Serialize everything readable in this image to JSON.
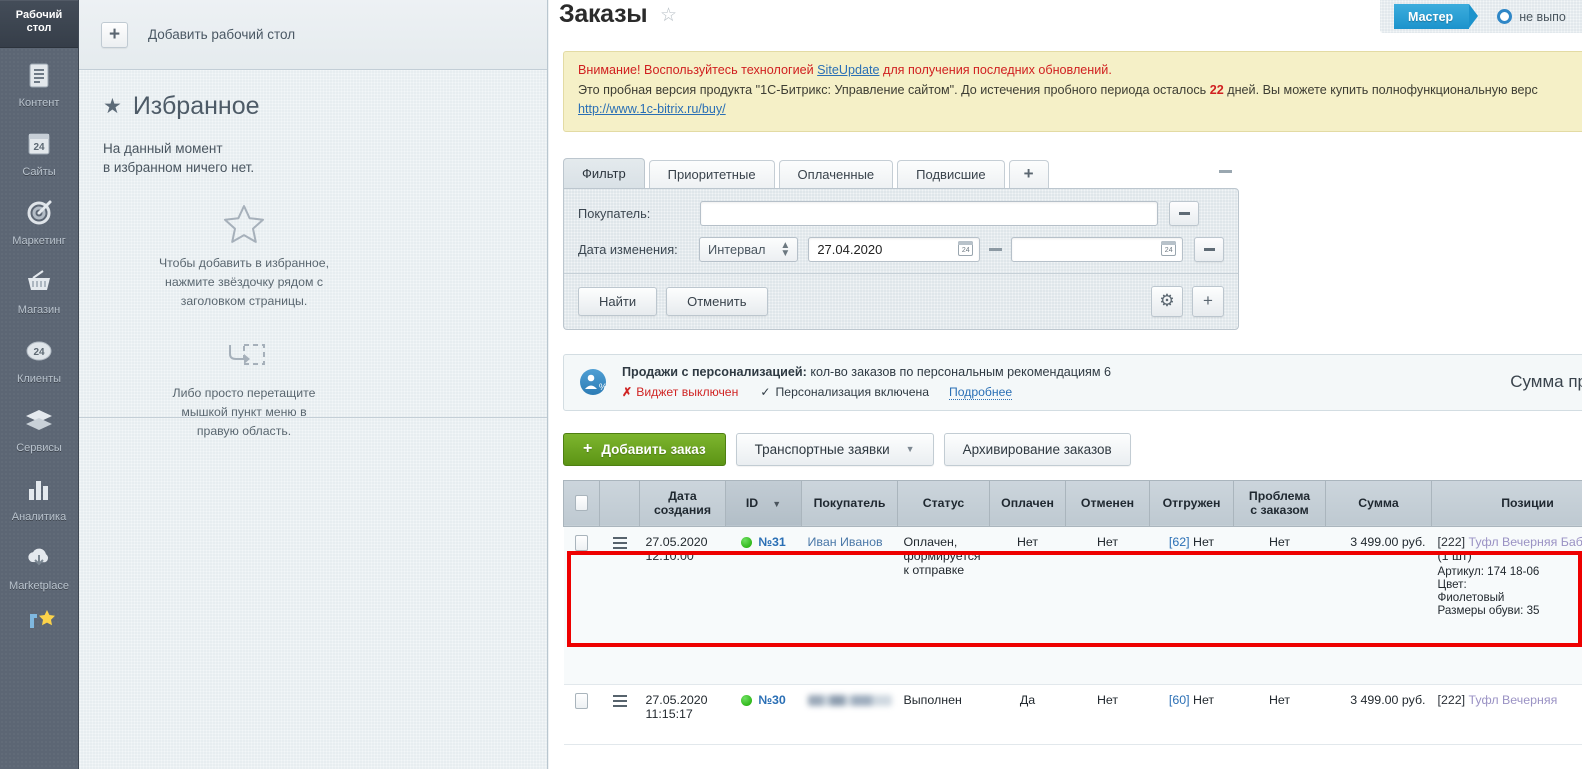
{
  "sidebar": {
    "desktop_label": "Рабочий\nстол",
    "desktop_line1": "Рабочий",
    "desktop_line2": "стол",
    "items": [
      {
        "label": "Контент",
        "icon": "content-lines-icon"
      },
      {
        "label": "Сайты",
        "icon": "sites-24-icon"
      },
      {
        "label": "Маркетинг",
        "icon": "marketing-target-icon"
      },
      {
        "label": "Магазин",
        "icon": "shop-basket-icon"
      },
      {
        "label": "Клиенты",
        "icon": "clients-24-icon"
      },
      {
        "label": "Сервисы",
        "icon": "services-layers-icon"
      },
      {
        "label": "Аналитика",
        "icon": "analytics-bars-icon"
      },
      {
        "label": "Marketplace",
        "icon": "marketplace-cloud-icon"
      },
      {
        "label": "",
        "icon": "settings-star-icon"
      }
    ]
  },
  "favorites": {
    "add_desktop_label": "Добавить рабочий стол",
    "title": "Избранное",
    "empty_line1": "На данный момент",
    "empty_line2": "в избранном ничего нет.",
    "hint1_line1": "Чтобы добавить в избранное,",
    "hint1_line2": "нажмите звёздочку рядом с",
    "hint1_line3": "заголовком страницы.",
    "hint2_line1": "Либо просто перетащите",
    "hint2_line2": "мышкой пункт меню в",
    "hint2_line3": "правую область."
  },
  "header": {
    "page_title": "Заказы",
    "star_icon": "favorite-star-icon",
    "master_button": "Мастер",
    "radio_label": "не выпо"
  },
  "warning": {
    "line1_prefix": "Внимание! Воспользуйтесь технологией ",
    "line1_link": "SiteUpdate",
    "line1_suffix": " для получения последних обновлений.",
    "line2_a": "Это пробная версия продукта \"1С-Битрикс: Управление сайтом\". До истечения пробного периода осталось ",
    "line2_days": "22",
    "line2_b": " дней. Вы можете купить полнофункциональную верс",
    "link_url": "http://www.1c-bitrix.ru/buy/"
  },
  "filter": {
    "tabs": [
      {
        "label": "Фильтр",
        "active": true
      },
      {
        "label": "Приоритетные",
        "active": false
      },
      {
        "label": "Оплаченные",
        "active": false
      },
      {
        "label": "Подвисшие",
        "active": false
      },
      {
        "label": "+",
        "active": false
      }
    ],
    "buyer_label": "Покупатель:",
    "buyer_value": "",
    "buyer_placeholder": "",
    "date_label": "Дата изменения:",
    "date_mode": "Интервал",
    "date_from": "27.04.2020",
    "date_to": "",
    "date_to_placeholder": "",
    "find_button": "Найти",
    "cancel_button": "Отменить",
    "gear_icon": "gear-icon",
    "add_icon": "plus-icon"
  },
  "personalization": {
    "title_text": "Продажи с персонализацией:",
    "detail_text": " кол-во заказов по персональным рекомендациям 6",
    "widget_off": "Виджет выключен",
    "perso_on": "Персонализация включена",
    "more_link": "Подробнее",
    "sum_label": "Сумма прод"
  },
  "grid_toolbar": {
    "add_order": "Добавить заказ",
    "transport": "Транспортные заявки",
    "archive": "Архивирование заказов"
  },
  "table": {
    "columns": [
      "",
      "",
      "Дата\nсоздания",
      "ID",
      "Покупатель",
      "Статус",
      "Оплачен",
      "Отменен",
      "Отгружен",
      "Проблема\nс заказом",
      "Сумма",
      "Позиции"
    ],
    "col_date_l1": "Дата",
    "col_date_l2": "создания",
    "col_id": "ID",
    "col_buyer": "Покупатель",
    "col_status": "Статус",
    "col_paid": "Оплачен",
    "col_cancelled": "Отменен",
    "col_shipped": "Отгружен",
    "col_problem_l1": "Проблема",
    "col_problem_l2": "с заказом",
    "col_sum": "Сумма",
    "col_positions": "Позиции",
    "rows": [
      {
        "date_l1": "27.05.2020",
        "date_l2": "12:10:00",
        "id": "№31",
        "buyer": "Иван Иванов",
        "buyer_blurred": false,
        "status": "Оплачен, формируется к отправке",
        "paid": "Нет",
        "cancelled": "Нет",
        "shipped_num": "[62]",
        "shipped": "Нет",
        "problem": "Нет",
        "sum": "3 499.00 руб.",
        "pos_id": "[222]",
        "pos_name": "Туфл Вечерняя Бабочка",
        "pos_qty": "(1 шт)",
        "pos_article": "Артикул: 174 18-06",
        "pos_color_label": "Цвет:",
        "pos_color": "Фиолетовый",
        "pos_size": "Размеры обуви: 35",
        "highlighted": true
      },
      {
        "date_l1": "27.05.2020",
        "date_l2": "11:15:17",
        "id": "№30",
        "buyer": "",
        "buyer_blurred": true,
        "status": "Выполнен",
        "paid": "Да",
        "cancelled": "Нет",
        "shipped_num": "[60]",
        "shipped": "Нет",
        "problem": "Нет",
        "sum": "3 499.00 руб.",
        "pos_id": "[222]",
        "pos_name": "Туфл Вечерняя",
        "pos_qty": "",
        "pos_article": "",
        "pos_color_label": "",
        "pos_color": "",
        "pos_size": "",
        "highlighted": false
      }
    ]
  },
  "colors": {
    "sidebar_bg": "#5c6674",
    "accent_blue": "#2a6fb5",
    "warn_bg": "#f5f0c7",
    "warn_red": "#d02020",
    "green_button": "#7db52e",
    "highlight_red": "#ee0000",
    "status_green": "#18a800"
  }
}
